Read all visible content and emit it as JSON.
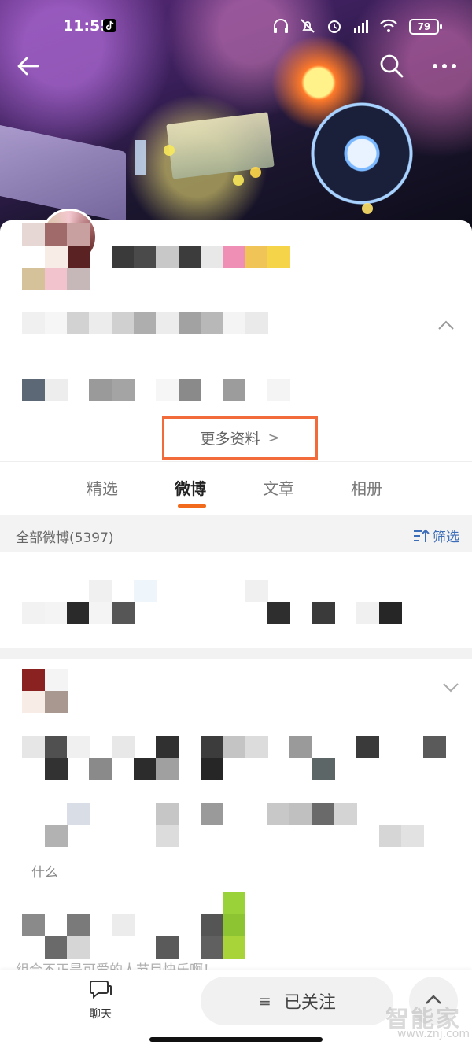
{
  "status_bar": {
    "time": "11:55",
    "battery": "79"
  },
  "profile": {
    "more_info_label": "更多资料",
    "more_info_chevron": ">"
  },
  "tabs": [
    {
      "label": "精选"
    },
    {
      "label": "微博"
    },
    {
      "label": "文章"
    },
    {
      "label": "相册"
    }
  ],
  "feed": {
    "header_label": "全部微博(5397)",
    "filter_label": "筛选"
  },
  "post_fragments": {
    "line1": "什么",
    "line2": "组合不正是可爱的人节目快乐啊！"
  },
  "bottom_bar": {
    "chat_label": "聊天",
    "follow_label": "已关注",
    "follow_menu_icon": "≡"
  },
  "watermark": {
    "text": "智能家",
    "url": "www.znj.com"
  },
  "colors": {
    "accent_orange": "#f26b1d",
    "highlight_border": "#f26b3a",
    "link_blue": "#3c6db8"
  }
}
